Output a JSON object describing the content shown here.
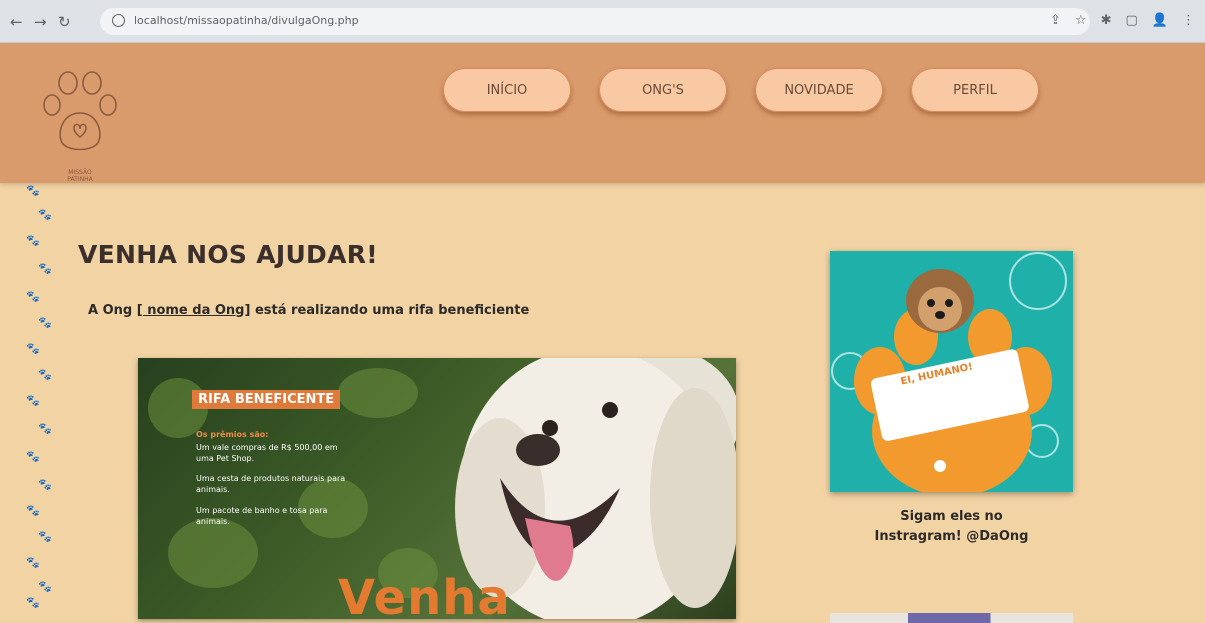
{
  "browser": {
    "url": "localhost/missaopatinha/divulgaOng.php",
    "icons": [
      "back-icon",
      "forward-icon",
      "reload-icon",
      "share-icon",
      "star-icon",
      "extensions-icon",
      "sidebar-icon",
      "profile-icon",
      "menu-icon"
    ]
  },
  "header": {
    "logo_line1": "MISSÃO",
    "logo_line2": "PATINHA",
    "nav": [
      {
        "label": "INÍCIO"
      },
      {
        "label": "ONG'S"
      },
      {
        "label": "NOVIDADE"
      },
      {
        "label": "PERFIL"
      }
    ],
    "colors": {
      "header_bg": "#d99a6c",
      "pill_bg": "#f8c9a2",
      "page_bg": "#f2d3a4"
    }
  },
  "main": {
    "headline": "VENHA NOS AJUDAR!",
    "intro_before": "A Ong ",
    "ong_name": "[ nome da Ong]",
    "intro_after": " está realizando uma rifa beneficiente",
    "rifa": {
      "title": "RIFA BENEFICENTE",
      "prizes_label": "Os prêmios são:",
      "prize_1": "Um vale compras de R$ 500,00 em uma Pet Shop.",
      "prize_2": "Uma cesta de produtos naturais para animais.",
      "prize_3": "Um pacote de banho e tosa para animais.",
      "cta": "Venha"
    }
  },
  "sidebar": {
    "card_text": "EI, HUMANO!",
    "caption_line1": "Sigam eles no",
    "caption_line2": "Instragram! @DaOng"
  }
}
